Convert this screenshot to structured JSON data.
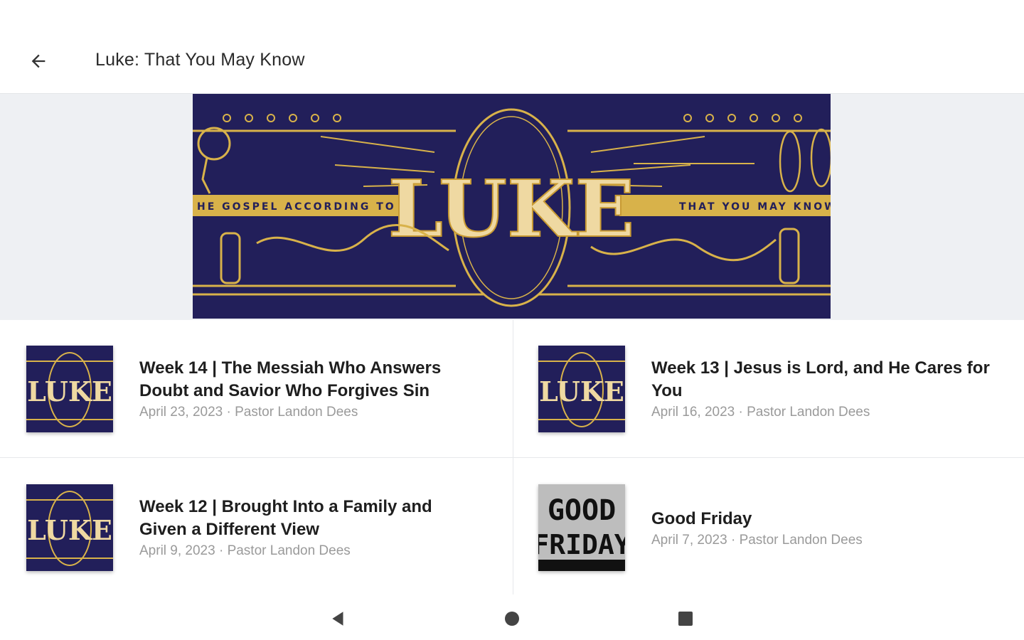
{
  "app_bar": {
    "title": "Luke: That You May Know",
    "back_icon": "arrow-left-icon"
  },
  "banner": {
    "left_text": "HE GOSPEL ACCORDING TO",
    "main_word": "LUKE",
    "right_text": "THAT YOU MAY KNOW",
    "colors": {
      "background": "#221f5a",
      "gold": "#d8b24a"
    }
  },
  "sermons": [
    {
      "title": "Week 14 | The Messiah Who Answers Doubt and Savior Who Forgives Sin",
      "meta": "April 23, 2023 · Pastor Landon Dees",
      "thumb_text": "LUKE"
    },
    {
      "title": "Week 13 | Jesus is Lord, and He Cares for You",
      "meta": "April 16, 2023 · Pastor Landon Dees",
      "thumb_text": "LUKE"
    },
    {
      "title": "Week 12 | Brought Into a Family and Given a Different View",
      "meta": "April 9, 2023 · Pastor Landon Dees",
      "thumb_text": "LUKE"
    },
    {
      "title": "Good Friday",
      "meta": "April 7, 2023 · Pastor Landon Dees",
      "thumb_text_1": "GOOD",
      "thumb_text_2": "FRIDAY"
    }
  ],
  "nav_bar": {
    "back": "triangle-back-icon",
    "home": "circle-home-icon",
    "recents": "square-recents-icon"
  }
}
